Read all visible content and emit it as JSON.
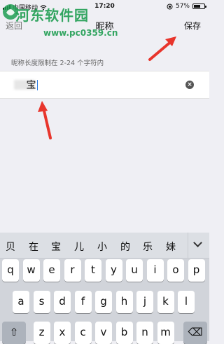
{
  "status_bar": {
    "carrier": "中国移动",
    "time": "17:20",
    "battery_percent": "57%",
    "battery_level": 0.57
  },
  "nav": {
    "back_label": "返回",
    "title": "昵称",
    "save_label": "保存"
  },
  "watermark": {
    "name": "河东软件园",
    "url": "www.pc0359.cn"
  },
  "form": {
    "hint": "昵称长度限制在 2-24 个字符内",
    "value_visible": "宝"
  },
  "keyboard": {
    "candidates": [
      "贝",
      "在",
      "宝",
      "儿",
      "小",
      "的",
      "乐",
      "妹"
    ],
    "row1": [
      "q",
      "w",
      "e",
      "r",
      "t",
      "y",
      "u",
      "i",
      "o",
      "p"
    ],
    "row2": [
      "a",
      "s",
      "d",
      "f",
      "g",
      "h",
      "j",
      "k",
      "l"
    ],
    "row3": [
      "z",
      "x",
      "c",
      "v",
      "b",
      "n",
      "m"
    ]
  },
  "icons": {
    "wifi": "wifi-icon",
    "signal": "signal-icon",
    "battery": "battery-icon",
    "clear": "clear-icon",
    "shift": "shift-icon",
    "backspace": "backspace-icon",
    "expand": "chevron-down-icon"
  },
  "colors": {
    "accent_arrow": "#e8352c",
    "watermark": "#1f9e52",
    "caret": "#2a7ae2"
  }
}
